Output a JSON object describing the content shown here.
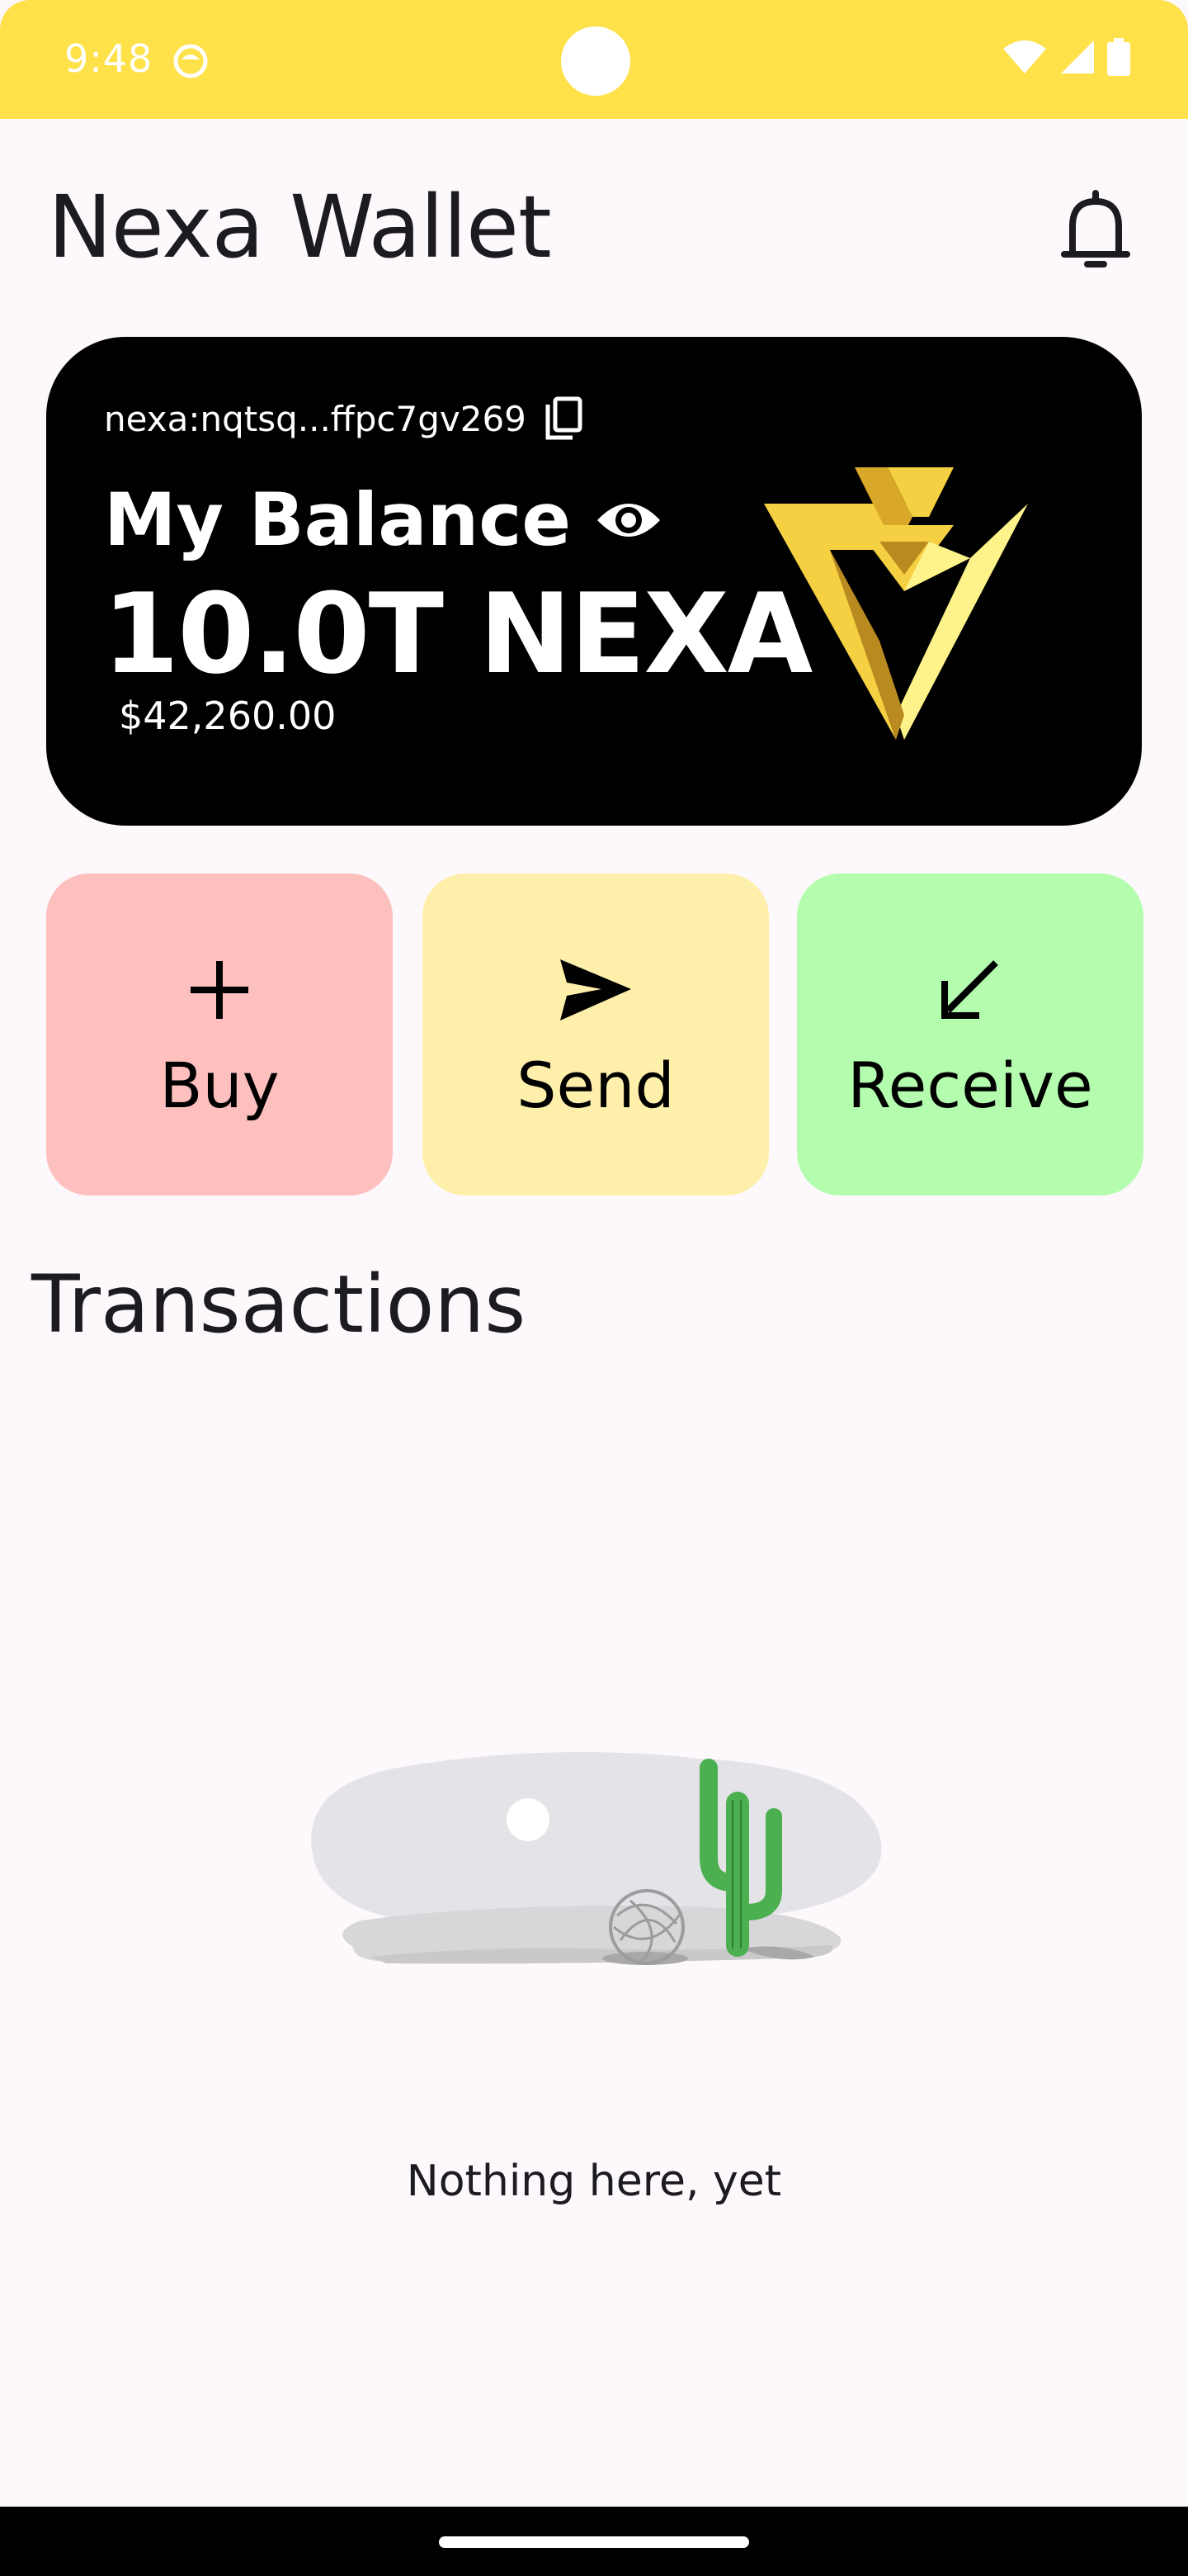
{
  "status_bar": {
    "time": "9:48"
  },
  "header": {
    "title": "Nexa Wallet"
  },
  "balance_card": {
    "address": "nexa:nqtsq...ffpc7gv269",
    "label": "My Balance",
    "amount": "10.0T NEXA",
    "fiat_value": "$42,260.00"
  },
  "actions": [
    {
      "label": "Buy",
      "icon": "plus-icon",
      "color": "#fec0bf"
    },
    {
      "label": "Send",
      "icon": "send-icon",
      "color": "#fef0aa"
    },
    {
      "label": "Receive",
      "icon": "receive-arrow-icon",
      "color": "#b5fdae"
    }
  ],
  "transactions": {
    "title": "Transactions",
    "empty_message": "Nothing here, yet"
  },
  "colors": {
    "status_bar": "#ffe14a",
    "background": "#fdf8fc",
    "card": "#000000",
    "logo_gold": "#f5d042"
  }
}
